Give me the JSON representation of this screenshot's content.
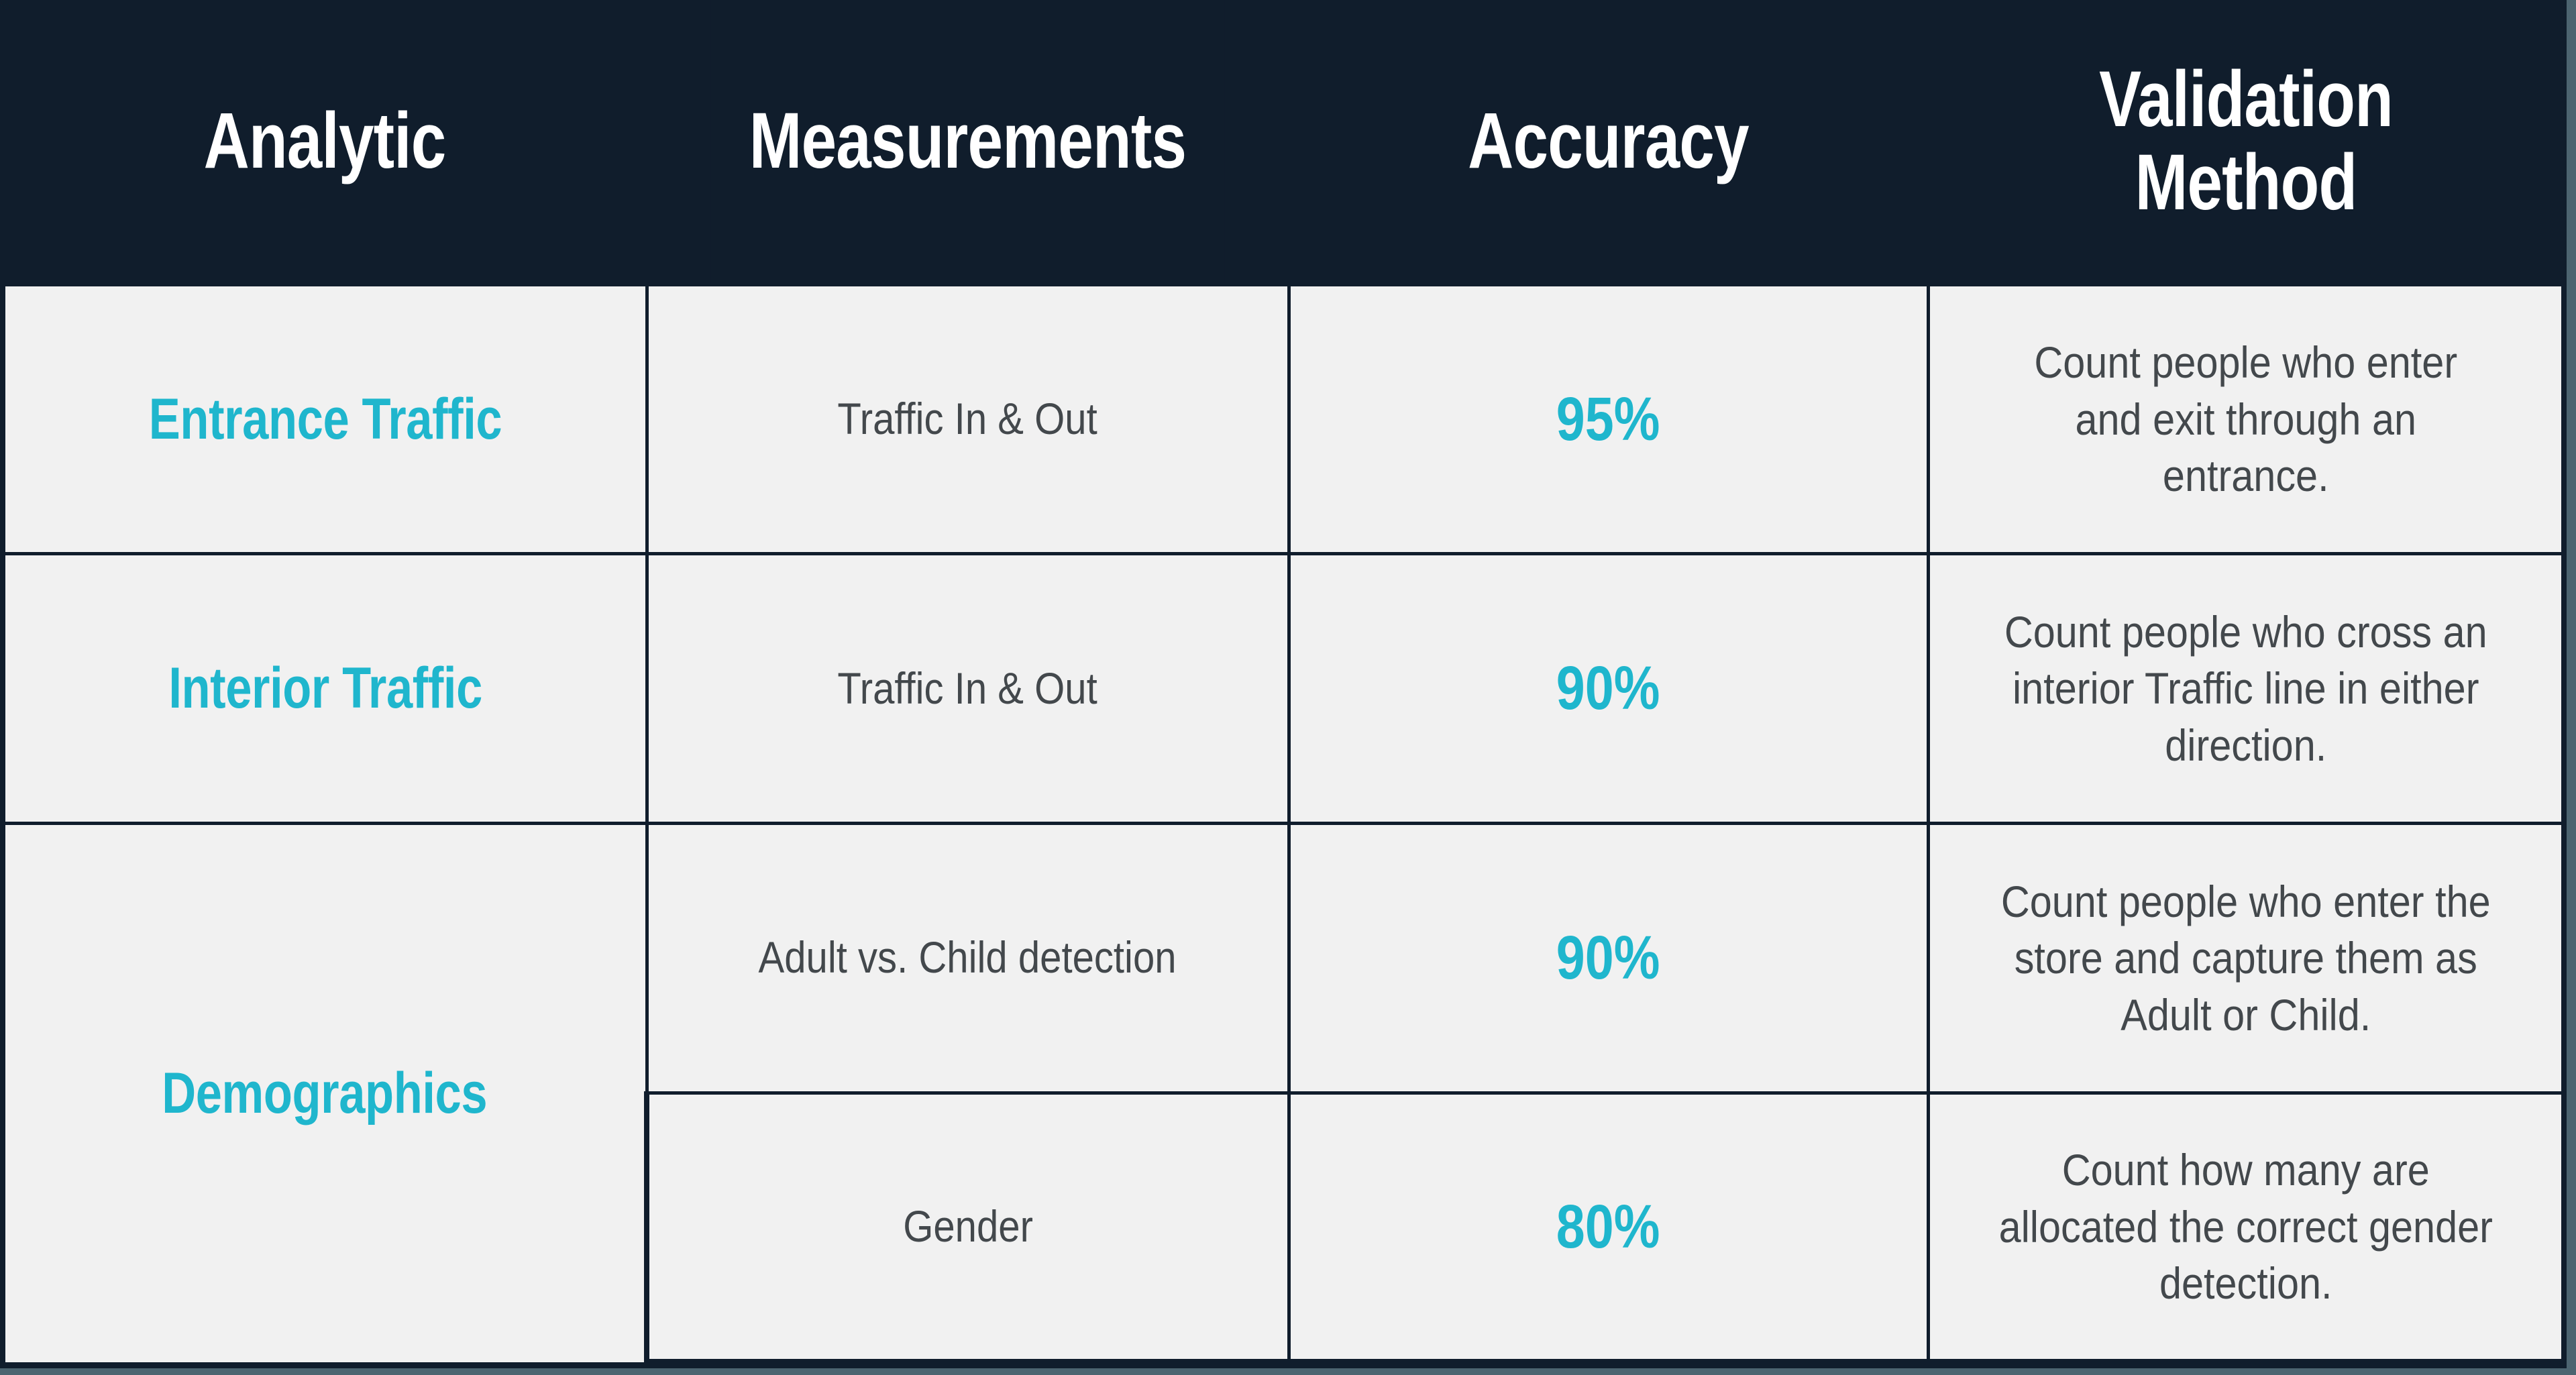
{
  "theme": {
    "header_bg": "#101d2c",
    "cell_bg": "#f1f1f1",
    "accent": "#1fb6cd",
    "body_text": "#43484c",
    "header_text": "#ffffff",
    "border": "#101d2c",
    "page_bg": "#4c6470"
  },
  "table": {
    "columns": [
      {
        "key": "analytic",
        "label": "Analytic"
      },
      {
        "key": "measurement",
        "label": "Measurements"
      },
      {
        "key": "accuracy",
        "label": "Accuracy"
      },
      {
        "key": "validation",
        "label": "Validation Method"
      }
    ],
    "rows": [
      {
        "analytic": "Entrance Traffic",
        "analytic_rowspan": 1,
        "measurement": "Traffic In & Out",
        "accuracy": "95%",
        "accuracy_value": 95,
        "validation": "Count people who enter and exit through an entrance."
      },
      {
        "analytic": "Interior Traffic",
        "analytic_rowspan": 1,
        "measurement": "Traffic In & Out",
        "accuracy": "90%",
        "accuracy_value": 90,
        "validation": "Count people who cross an interior Traffic line in either direction."
      },
      {
        "analytic": "Demographics",
        "analytic_rowspan": 2,
        "measurement": "Adult vs. Child detection",
        "accuracy": "90%",
        "accuracy_value": 90,
        "validation": "Count people who enter the store and capture them as Adult or Child."
      },
      {
        "analytic": null,
        "analytic_rowspan": 0,
        "measurement": "Gender",
        "accuracy": "80%",
        "accuracy_value": 80,
        "validation": "Count how many are allocated the correct gender detection."
      }
    ]
  }
}
